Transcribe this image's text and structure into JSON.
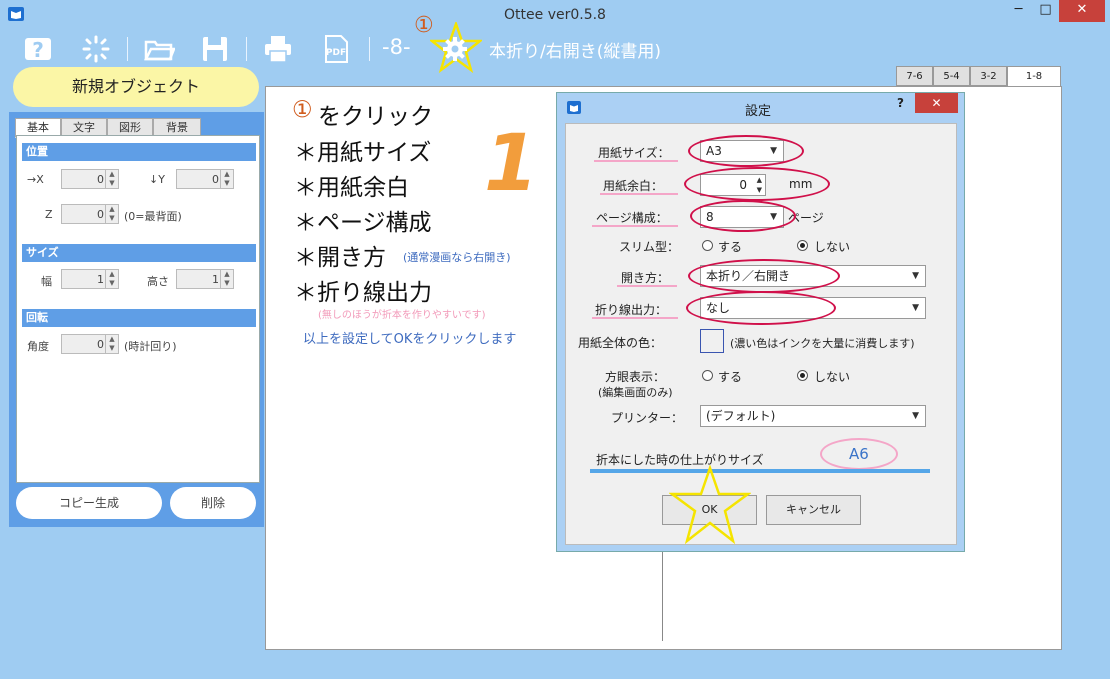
{
  "window": {
    "title": "Ottee ver0.5.8",
    "minimize": "─",
    "maximize": "□",
    "close": "✕"
  },
  "toolbar": {
    "icons": [
      "help-icon",
      "loading-icon",
      "open-folder-icon",
      "save-icon",
      "print-icon",
      "pdf-icon",
      "settings-icon"
    ],
    "page_indicator": "-8-",
    "step_marker": "①",
    "binding_mode": "本折り/右開き(縦書用)",
    "pdf_label": "PDF"
  },
  "left_panel": {
    "new_object_label": "新規オブジェクト",
    "tabs": [
      "基本",
      "文字",
      "図形",
      "背景"
    ],
    "position_section": "位置",
    "x_label": "→X",
    "x_value": "0",
    "y_label": "↓Y",
    "y_value": "0",
    "z_label": "Z",
    "z_value": "0",
    "z_note": "(0=最背面)",
    "size_section": "サイズ",
    "width_label": "幅",
    "width_value": "1",
    "height_label": "高さ",
    "height_value": "1",
    "rotation_section": "回転",
    "angle_label": "角度",
    "angle_value": "0",
    "angle_note": "(時計回り)",
    "copy_button": "コピー生成",
    "delete_button": "削除"
  },
  "page_tabs": [
    "7-6",
    "5-4",
    "3-2",
    "1-8"
  ],
  "instructions": {
    "step1_mark": "①",
    "step1": "をクリック",
    "items": [
      "＊用紙サイズ",
      "＊用紙余白",
      "＊ページ構成",
      "＊開き方",
      "＊折り線出力"
    ],
    "open_note": "(通常漫画なら右開き)",
    "fold_note": "(無しのほうが折本を作りやすいです)",
    "footer": "以上を設定してOKをクリックします",
    "annotation_number": "1"
  },
  "dialog": {
    "title": "設定",
    "help": "?",
    "close": "✕",
    "paper_size_label": "用紙サイズ：",
    "paper_size": "A3",
    "margin_label": "用紙余白：",
    "margin_value": "0",
    "margin_unit": "mm",
    "pages_label": "ページ構成：",
    "pages_value": "8",
    "pages_unit": "ページ",
    "slim_label": "スリム型：",
    "slim_yes": "する",
    "slim_no": "しない",
    "open_label": "開き方：",
    "open_value": "本折り／右開き",
    "fold_label": "折り線出力：",
    "fold_value": "なし",
    "paper_color_label": "用紙全体の色：",
    "paper_color_note": "(濃い色はインクを大量に消費します)",
    "paper_color": "#ffffff",
    "grid_label": "方眼表示：",
    "grid_sub": "(編集画面のみ)",
    "grid_yes": "する",
    "grid_no": "しない",
    "printer_label": "プリンター：",
    "printer_value": "(デフォルト)",
    "finish_label": "折本にした時の仕上がりサイズ",
    "finish_value": "A6",
    "ok": "OK",
    "cancel": "キャンセル"
  },
  "colors": {
    "accent": "#5f9ee6",
    "highlight": "#d0104a",
    "star": "#f5e400"
  }
}
